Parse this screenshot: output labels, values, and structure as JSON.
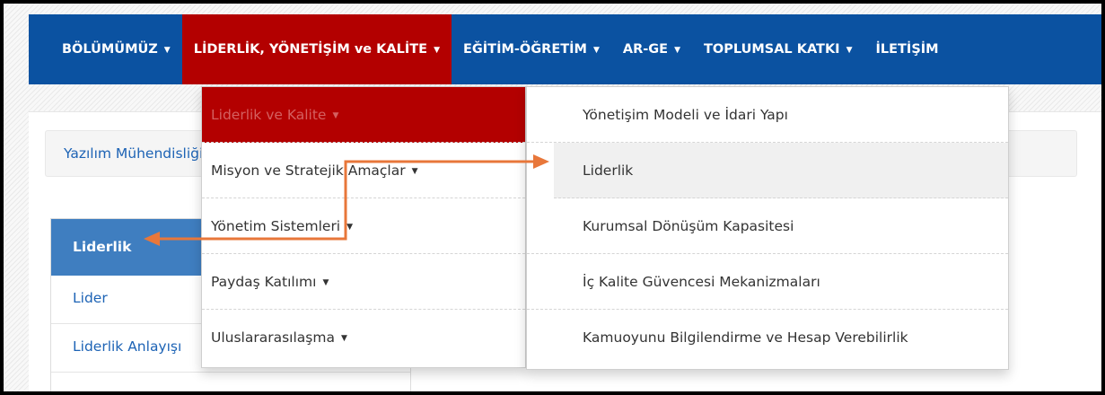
{
  "navbar": {
    "items": [
      {
        "label": "BÖLÜMÜMÜZ",
        "caret": true
      },
      {
        "label": "LİDERLİK, YÖNETİŞİM ve KALİTE",
        "caret": true
      },
      {
        "label": "EĞİTİM-ÖĞRETİM",
        "caret": true
      },
      {
        "label": "AR-GE",
        "caret": true
      },
      {
        "label": "TOPLUMSAL KATKI",
        "caret": true
      },
      {
        "label": "İLETİŞİM",
        "caret": false
      }
    ]
  },
  "breadcrumb": {
    "text": "Yazılım Mühendisliği"
  },
  "sidebar": {
    "active": "Liderlik",
    "items": [
      "Lider",
      "Liderlik Anlayışı"
    ]
  },
  "menu_level1": {
    "items": [
      {
        "label": "Liderlik ve Kalite"
      },
      {
        "label": "Misyon ve Stratejik Amaçlar"
      },
      {
        "label": "Yönetim Sistemleri"
      },
      {
        "label": "Paydaş Katılımı"
      },
      {
        "label": "Uluslararasılaşma"
      }
    ]
  },
  "menu_level2": {
    "items": [
      "Yönetişim Modeli ve İdari Yapı",
      "Liderlik",
      "Kurumsal Dönüşüm Kapasitesi",
      "İç Kalite Güvencesi Mekanizmaları",
      "Kamuoyunu Bilgilendirme ve Hesap Verebilirlik"
    ]
  },
  "colors": {
    "navbar": "#0b52a1",
    "active_red": "#b30000",
    "sidebar_active": "#3f7ec0",
    "annotation_arrow": "#e8773a"
  }
}
